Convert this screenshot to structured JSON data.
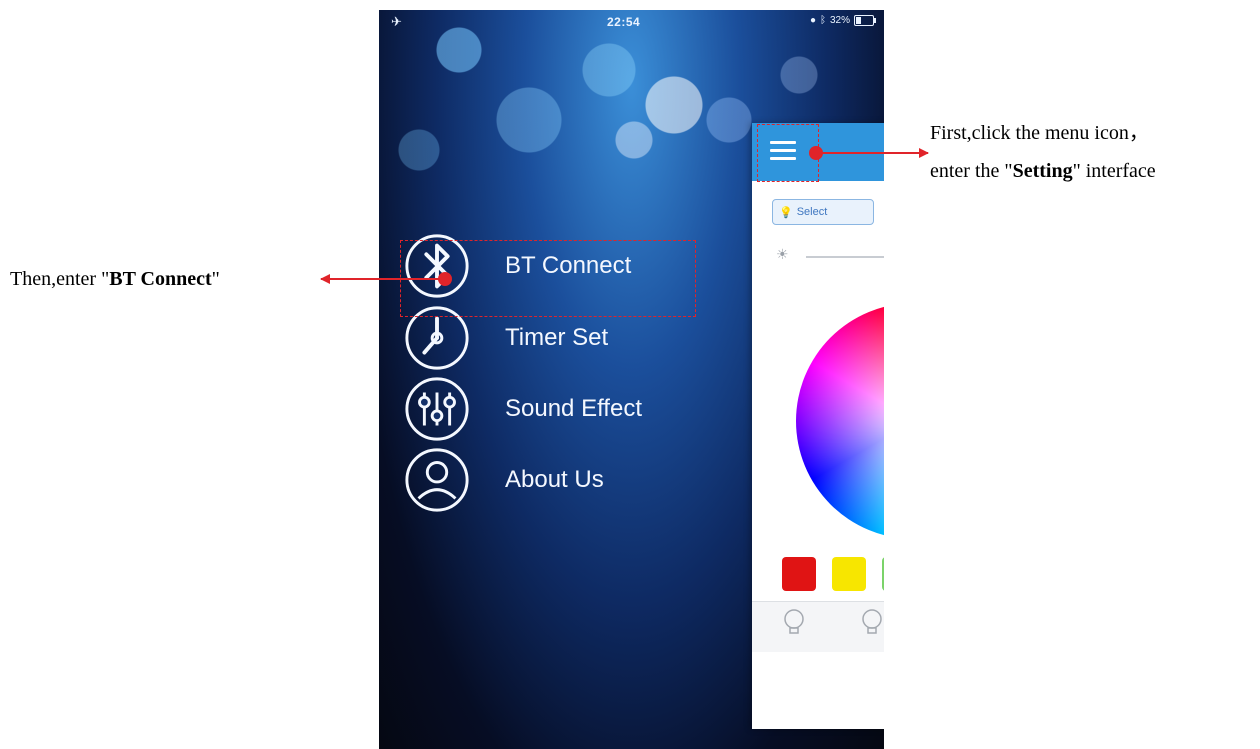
{
  "status_bar": {
    "time": "22:54",
    "battery_text": "32%",
    "battery_level": 0.32,
    "icons": [
      "airplane-icon",
      "alarm-icon",
      "bluetooth-icon",
      "battery-icon"
    ]
  },
  "menu": {
    "items": [
      {
        "label": "BT Connect",
        "icon": "bluetooth-icon"
      },
      {
        "label": "Timer Set",
        "icon": "clock-icon"
      },
      {
        "label": "Sound Effect",
        "icon": "equalizer-icon"
      },
      {
        "label": "About Us",
        "icon": "user-icon"
      }
    ]
  },
  "panel": {
    "select_label": "Select",
    "swatch_colors": [
      "#e01414",
      "#f7e600",
      "#7bd36a"
    ],
    "header_color": "#2f95dc",
    "tab_icons": [
      "bulb-icon",
      "bulb-outline-icon"
    ]
  },
  "annotations": {
    "left": {
      "prefix": "Then,enter \"",
      "bold": "BT Connect",
      "suffix": "\""
    },
    "right_line1": "First,click the menu icon，",
    "right_line2": {
      "prefix": "enter the \"",
      "bold": "Setting",
      "suffix": "\" interface"
    },
    "accent_color": "#e0242a"
  }
}
